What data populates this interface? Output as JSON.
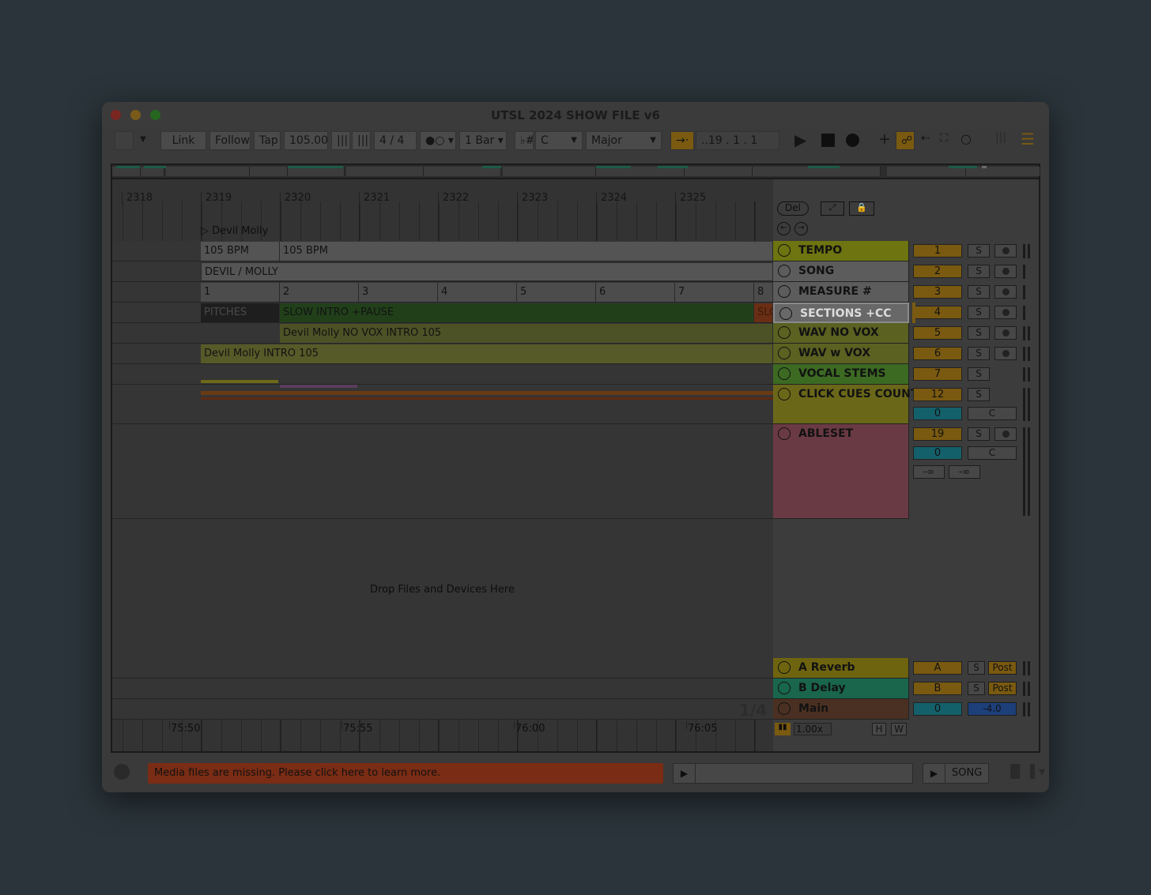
{
  "window": {
    "title": "UTSL 2024 SHOW FILE v6"
  },
  "toolbar": {
    "link": "Link",
    "follow": "Follow",
    "tap": "Tap",
    "tempo": "105.00",
    "time_sig_num": "4",
    "time_sig_sep": "/",
    "time_sig_den": "4",
    "quant": "1 Bar",
    "key": "C",
    "scale": "Major",
    "position": "..19 .   1 .   1"
  },
  "ruler": {
    "bars": [
      "2318",
      "2319",
      "2320",
      "2321",
      "2322",
      "2323",
      "2324",
      "2325"
    ]
  },
  "locator": "Devil Molly",
  "clips": {
    "tempo_a": "105 BPM",
    "tempo_b": "105 BPM",
    "song": "DEVIL / MOLLY",
    "measures": [
      "1",
      "2",
      "3",
      "4",
      "5",
      "6",
      "7",
      "8"
    ],
    "pitches": "PITCHES",
    "sections": "SLOW INTRO +PAUSE",
    "sections_cut": "SLO",
    "wav_no_vox": "Devil Molly NO VOX INTRO 105",
    "wav_vox": "Devil Molly INTRO 105"
  },
  "drop_text": "Drop Files and Devices Here",
  "controls": {
    "del": "Del"
  },
  "tracks": [
    {
      "name": "TEMPO",
      "num": "1",
      "s": "S",
      "color": "#6e7410"
    },
    {
      "name": "SONG",
      "num": "2",
      "s": "S",
      "color": "#5c5c5c"
    },
    {
      "name": "MEASURE #",
      "num": "3",
      "s": "S",
      "color": "#5c5c5c"
    },
    {
      "name": "SECTIONS +CC",
      "num": "4",
      "s": "S",
      "color": "#686868"
    },
    {
      "name": "WAV NO VOX",
      "num": "5",
      "s": "S",
      "color": "#5a6121"
    },
    {
      "name": "WAV w VOX",
      "num": "6",
      "s": "S",
      "color": "#5a6121"
    },
    {
      "name": "VOCAL STEMS",
      "num": "7",
      "s": "S",
      "color": "#3c6a22"
    },
    {
      "name": "CLICK CUES COUNT",
      "num": "12",
      "s": "S",
      "sub": "0",
      "c": "C",
      "color": "#6b6719"
    },
    {
      "name": "ABLESET",
      "num": "19",
      "s": "S",
      "sub": "0",
      "c": "C",
      "inf1": "-∞",
      "inf2": "-∞",
      "color": "#6a3a44"
    }
  ],
  "returns": [
    {
      "name": "A Reverb",
      "num": "A",
      "s": "S",
      "post": "Post",
      "color": "#6e6410"
    },
    {
      "name": "B Delay",
      "num": "B",
      "s": "S",
      "post": "Post",
      "color": "#19664d"
    },
    {
      "name": "Main",
      "num": "0",
      "vol": "-4.0",
      "color": "#4a3022"
    }
  ],
  "page": "1/4",
  "time_ruler": [
    "75:50",
    "75:55",
    "76:00",
    "76:05"
  ],
  "zoom": "1.00x",
  "hw": {
    "h": "H",
    "w": "W"
  },
  "status": {
    "message": "Media files are missing. Please click here to learn more.",
    "song": "SONG"
  },
  "colors": {
    "accent": "#7a5a10",
    "alert": "#7a2c14"
  }
}
